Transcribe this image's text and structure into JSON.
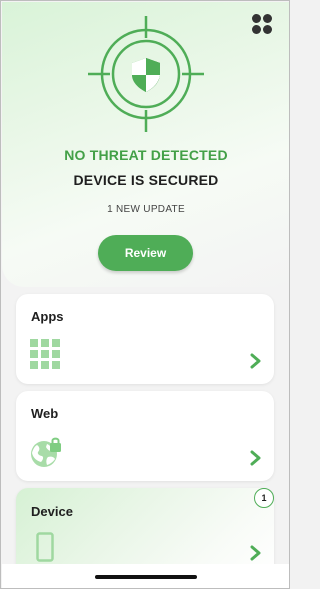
{
  "header": {
    "menu_icon": "grid-four-dots-icon"
  },
  "status": {
    "icon": "shield-target-icon",
    "title": "NO THREAT DETECTED",
    "subtitle": "DEVICE IS SECURED",
    "update_text": "1 NEW UPDATE",
    "review_label": "Review"
  },
  "cards": {
    "apps": {
      "title": "Apps",
      "icon": "apps-grid-icon"
    },
    "web": {
      "title": "Web",
      "icon": "globe-lock-icon"
    },
    "device": {
      "title": "Device",
      "icon": "phone-icon",
      "badge": "1"
    }
  },
  "colors": {
    "accent": "#4fad57",
    "title_green": "#43a047",
    "icon_light_green": "#9fd8a0"
  }
}
